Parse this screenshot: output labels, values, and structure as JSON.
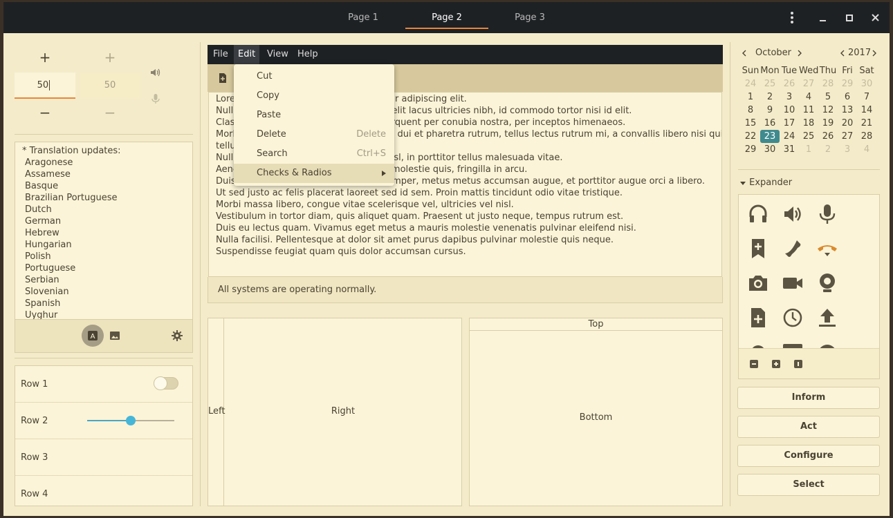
{
  "header": {
    "tabs": [
      {
        "label": "Page 1",
        "active": false
      },
      {
        "label": "Page 2",
        "active": true
      },
      {
        "label": "Page 3",
        "active": false
      }
    ],
    "menu_icon": "kebab-menu-icon",
    "minimize_icon": "minimize-icon",
    "maximize_icon": "maximize-icon",
    "close_icon": "close-icon"
  },
  "spin_buttons": [
    {
      "plus": "+",
      "minus": "−",
      "value": "50",
      "focused": true
    },
    {
      "plus": "+",
      "minus": "−",
      "value": "50",
      "focused": false
    }
  ],
  "side_icons": [
    "volume-icon",
    "microphone-icon"
  ],
  "list": {
    "header": "* Translation updates:",
    "items": [
      "Aragonese",
      "Assamese",
      "Basque",
      "Brazilian Portuguese",
      "Dutch",
      "German",
      "Hebrew",
      "Hungarian",
      "Polish",
      "Portuguese",
      "Serbian",
      "Slovenian",
      "Spanish",
      "Uyghur"
    ],
    "toolbar_icons": [
      "text-format-icon",
      "image-icon",
      "gear-icon"
    ]
  },
  "rows": [
    {
      "label": "Row 1",
      "control": "switch",
      "on": false
    },
    {
      "label": "Row 2",
      "control": "slider",
      "value": 0.5
    },
    {
      "label": "Row 3"
    },
    {
      "label": "Row 4"
    }
  ],
  "menubar": {
    "items": [
      "File",
      "Edit",
      "View",
      "Help"
    ],
    "open": "Edit"
  },
  "popup_menu": {
    "items": [
      {
        "label": "Cut",
        "accel": ""
      },
      {
        "label": "Copy",
        "accel": ""
      },
      {
        "label": "Paste",
        "accel": ""
      },
      {
        "label": "Delete",
        "accel": "Delete"
      },
      {
        "label": "Search",
        "accel": "Ctrl+S"
      },
      {
        "label": "Checks & Radios",
        "accel": "",
        "submenu": true
      }
    ]
  },
  "textview": {
    "lines": [
      "Lorem ipsum dolor sit amet, consectetur adipiscing elit.",
      "Nullam fringilla, est ut feugiat ultrices, elit lacus ultricies nibh, id commodo tortor nisi id elit.",
      "Class aptent taciti sociosqu ad litora torquent per conubia nostra, per inceptos himenaeos.",
      "Morbi vel elit erat. Maecenas dignissim, dui et pharetra rutrum, tellus lectus rutrum mi, a convallis libero nisi quis",
      "tellus.",
      "Nulla facilisi. Nullam eleifend lobortis nisl, in porttitor tellus malesuada vitae.",
      "Aenean lacus tellus, pellentesque quis molestie quis, fringilla in arcu.",
      "Duis elementum, tellus sed tristique semper, metus metus accumsan augue, et porttitor augue orci a libero.",
      "Ut sed justo ac felis placerat laoreet sed id sem. Proin mattis tincidunt odio vitae tristique.",
      "Morbi massa libero, congue vitae scelerisque vel, ultricies vel nisl.",
      "Vestibulum in tortor diam, quis aliquet quam. Praesent ut justo neque, tempus rutrum est.",
      "Duis eu lectus quam. Vivamus eget metus a mauris molestie venenatis pulvinar eleifend nisi.",
      "Nulla facilisi. Pellentesque at dolor sit amet purus dapibus pulvinar molestie quis neque.",
      "Suspendisse feugiat quam quis dolor accumsan cursus."
    ]
  },
  "statusbar": "All systems are operating normally.",
  "panes": {
    "left": "Left",
    "right": "Right",
    "top": "Top",
    "bottom": "Bottom"
  },
  "calendar": {
    "month": "October",
    "year": "2017",
    "weekdays": [
      "Sun",
      "Mon",
      "Tue",
      "Wed",
      "Thu",
      "Fri",
      "Sat"
    ],
    "weeks": [
      [
        {
          "d": "24",
          "dim": true
        },
        {
          "d": "25",
          "dim": true
        },
        {
          "d": "26",
          "dim": true
        },
        {
          "d": "27",
          "dim": true
        },
        {
          "d": "28",
          "dim": true
        },
        {
          "d": "29",
          "dim": true
        },
        {
          "d": "30",
          "dim": true
        }
      ],
      [
        {
          "d": "1"
        },
        {
          "d": "2"
        },
        {
          "d": "3"
        },
        {
          "d": "4"
        },
        {
          "d": "5"
        },
        {
          "d": "6"
        },
        {
          "d": "7"
        }
      ],
      [
        {
          "d": "8"
        },
        {
          "d": "9"
        },
        {
          "d": "10"
        },
        {
          "d": "11"
        },
        {
          "d": "12"
        },
        {
          "d": "13"
        },
        {
          "d": "14"
        }
      ],
      [
        {
          "d": "15"
        },
        {
          "d": "16"
        },
        {
          "d": "17"
        },
        {
          "d": "18"
        },
        {
          "d": "19"
        },
        {
          "d": "20"
        },
        {
          "d": "21"
        }
      ],
      [
        {
          "d": "22"
        },
        {
          "d": "23",
          "sel": true
        },
        {
          "d": "24"
        },
        {
          "d": "25"
        },
        {
          "d": "26"
        },
        {
          "d": "27"
        },
        {
          "d": "28"
        }
      ],
      [
        {
          "d": "29"
        },
        {
          "d": "30"
        },
        {
          "d": "31"
        },
        {
          "d": "1",
          "dim": true
        },
        {
          "d": "2",
          "dim": true
        },
        {
          "d": "3",
          "dim": true
        },
        {
          "d": "4",
          "dim": true
        }
      ]
    ]
  },
  "expander": {
    "label": "Expander",
    "icons": [
      "headphones-icon",
      "speaker-icon",
      "microphone-icon",
      "bookmark-add-icon",
      "phone-icon",
      "hangup-icon",
      "camera-icon",
      "video-camera-icon",
      "webcam-icon",
      "document-add-icon",
      "clock-icon",
      "upload-icon"
    ],
    "footer_icons": [
      "remove-icon",
      "add-icon",
      "one-icon"
    ]
  },
  "buttons": [
    "Inform",
    "Act",
    "Configure",
    "Select"
  ],
  "colors": {
    "accent": "#e8863a",
    "selection": "#3f8a8e",
    "slider": "#46b6d8",
    "header_bg": "#1e2124",
    "window_bg": "#f4ebca"
  }
}
